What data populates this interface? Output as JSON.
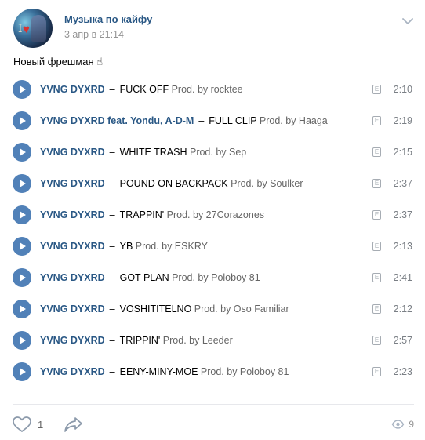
{
  "post": {
    "group_name": "Музыка по кайфу",
    "date": "3 апр в 21:14",
    "text": "Новый фрешман ☝"
  },
  "tracks": [
    {
      "artist": "YVNG DYXRD",
      "title": "FUCK OFF",
      "subtitle": "Prod. by rocktee",
      "explicit": "E",
      "duration": "2:10"
    },
    {
      "artist": "YVNG DYXRD feat. Yondu, A-D-M",
      "title": "FULL CLIP",
      "subtitle": "Prod. by Haaga",
      "explicit": "E",
      "duration": "2:19"
    },
    {
      "artist": "YVNG DYXRD",
      "title": "WHITE TRASH",
      "subtitle": "Prod. by Sep",
      "explicit": "E",
      "duration": "2:15"
    },
    {
      "artist": "YVNG DYXRD",
      "title": "POUND ON BACKPACK",
      "subtitle": "Prod. by Soulker",
      "explicit": "E",
      "duration": "2:37"
    },
    {
      "artist": "YVNG DYXRD",
      "title": "TRAPPIN'",
      "subtitle": "Prod. by 27Corazones",
      "explicit": "E",
      "duration": "2:37"
    },
    {
      "artist": "YVNG DYXRD",
      "title": "YB",
      "subtitle": "Prod. by ESKRY",
      "explicit": "E",
      "duration": "2:13"
    },
    {
      "artist": "YVNG DYXRD",
      "title": "GOT PLAN",
      "subtitle": "Prod. by Poloboy 81",
      "explicit": "E",
      "duration": "2:41"
    },
    {
      "artist": "YVNG DYXRD",
      "title": "VOSHITITELNO",
      "subtitle": "Prod. by Oso Familiar",
      "explicit": "E",
      "duration": "2:12"
    },
    {
      "artist": "YVNG DYXRD",
      "title": "TRIPPIN'",
      "subtitle": "Prod. by Leeder",
      "explicit": "E",
      "duration": "2:57"
    },
    {
      "artist": "YVNG DYXRD",
      "title": "EENY-MINY-MOE",
      "subtitle": "Prod. by Poloboy 81",
      "explicit": "E",
      "duration": "2:23"
    }
  ],
  "footer": {
    "likes": "1",
    "views": "9"
  },
  "colors": {
    "link": "#2a5885",
    "play": "#5181b8",
    "muted": "#939393"
  }
}
